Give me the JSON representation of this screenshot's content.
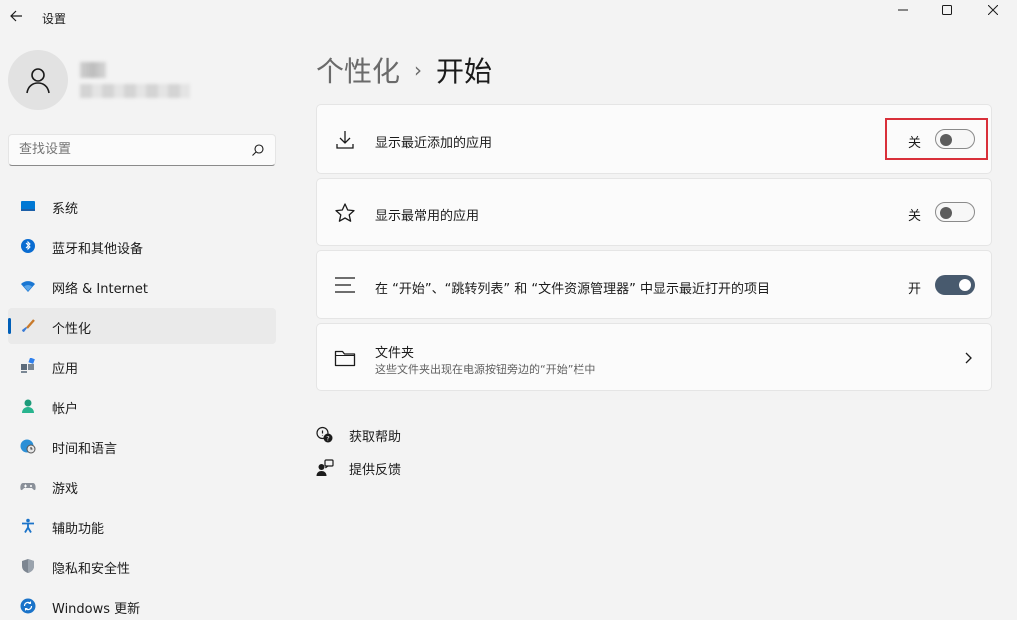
{
  "window": {
    "app_title": "设置"
  },
  "sidebar": {
    "search_placeholder": "查找设置",
    "items": [
      {
        "label": "系统",
        "icon": "monitor-icon"
      },
      {
        "label": "蓝牙和其他设备",
        "icon": "bluetooth-icon"
      },
      {
        "label": "网络 & Internet",
        "icon": "wifi-icon"
      },
      {
        "label": "个性化",
        "icon": "brush-icon",
        "active": true
      },
      {
        "label": "应用",
        "icon": "apps-icon"
      },
      {
        "label": "帐户",
        "icon": "account-icon"
      },
      {
        "label": "时间和语言",
        "icon": "globe-clock-icon"
      },
      {
        "label": "游戏",
        "icon": "gamepad-icon"
      },
      {
        "label": "辅助功能",
        "icon": "accessibility-icon"
      },
      {
        "label": "隐私和安全性",
        "icon": "shield-icon"
      },
      {
        "label": "Windows 更新",
        "icon": "update-icon"
      }
    ]
  },
  "header": {
    "parent": "个性化",
    "separator": "›",
    "current": "开始"
  },
  "settings": [
    {
      "title": "显示最近添加的应用",
      "state": "关",
      "on": false,
      "icon": "download-icon"
    },
    {
      "title": "显示最常用的应用",
      "state": "关",
      "on": false,
      "icon": "star-icon"
    },
    {
      "title": "在 “开始”、“跳转列表” 和 “文件资源管理器” 中显示最近打开的项目",
      "state": "开",
      "on": true,
      "icon": "list-icon"
    },
    {
      "title": "文件夹",
      "subtitle": "这些文件夹出现在电源按钮旁边的“开始”栏中",
      "icon": "folder-icon"
    }
  ],
  "help": {
    "get_help": "获取帮助",
    "feedback": "提供反馈"
  },
  "colors": {
    "accent": "#005fb8",
    "toggle_on": "#485a6e",
    "highlight": "#d9303a"
  }
}
